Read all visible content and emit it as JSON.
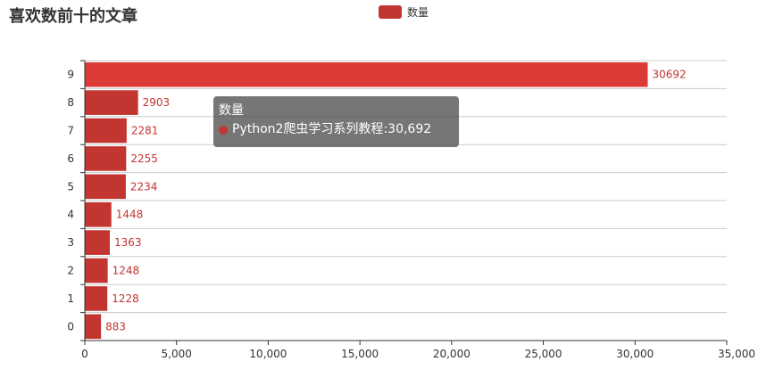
{
  "colors": {
    "bar": "#c23531",
    "bar_highlight": "#da3b37",
    "axis": "#333333",
    "grid": "#cccccc",
    "label": "#c23531"
  },
  "tooltip": {
    "title": "数量",
    "item_name": "Python2爬虫学习系列教程",
    "item_value": "30,692",
    "separator": ": "
  },
  "chart_data": {
    "type": "bar",
    "orientation": "horizontal",
    "title": "喜欢数前十的文章",
    "categories": [
      "0",
      "1",
      "2",
      "3",
      "4",
      "5",
      "6",
      "7",
      "8",
      "9"
    ],
    "series": [
      {
        "name": "数量",
        "values": [
          883,
          1228,
          1248,
          1363,
          1448,
          2234,
          2255,
          2281,
          2903,
          30692
        ]
      }
    ],
    "xlim": [
      0,
      35000
    ],
    "x_ticks": [
      0,
      5000,
      10000,
      15000,
      20000,
      25000,
      30000,
      35000
    ],
    "x_tick_labels": [
      "0",
      "5,000",
      "10,000",
      "15,000",
      "20,000",
      "25,000",
      "30,000",
      "35,000"
    ],
    "highlighted_category": "9",
    "legend_position": "top-center",
    "grid": true
  }
}
